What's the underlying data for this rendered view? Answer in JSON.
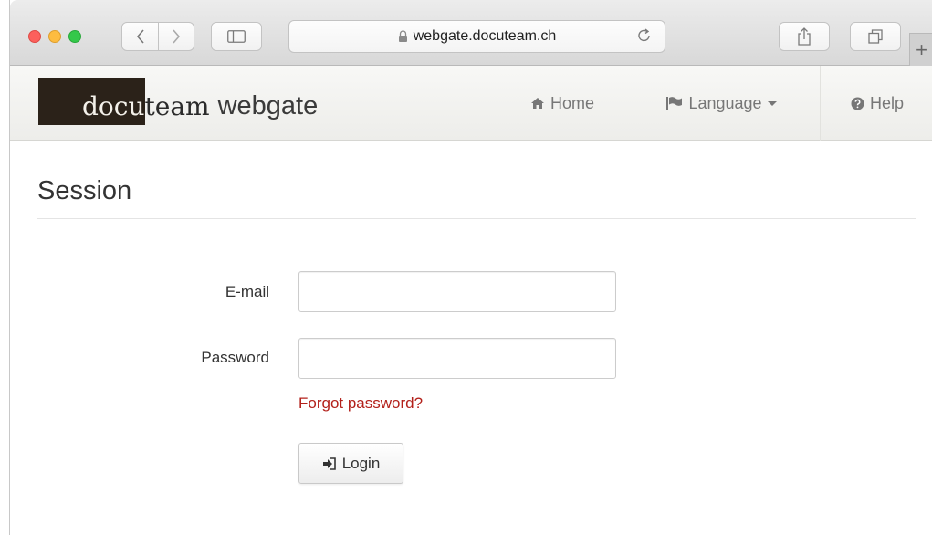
{
  "browser": {
    "address": "webgate.docuteam.ch",
    "icons": {
      "back": "chevron-left-icon",
      "forward": "chevron-right-icon",
      "sidebar": "sidebar-icon",
      "lock": "lock-icon",
      "reload": "reload-icon",
      "share": "share-icon",
      "tabs": "tabs-icon",
      "new_tab": "plus-icon"
    },
    "new_tab_label": "+"
  },
  "navbar": {
    "brand_part1": "docu",
    "brand_part2": "team",
    "brand_part3": "webgate",
    "items": [
      {
        "label": "Home",
        "icon": "home-icon"
      },
      {
        "label": "Language",
        "icon": "flag-icon"
      },
      {
        "label": "Help",
        "icon": "question-circle-icon"
      }
    ]
  },
  "page": {
    "title": "Session",
    "email_label": "E-mail",
    "email_value": "",
    "password_label": "Password",
    "password_value": "",
    "forgot_link": "Forgot password?",
    "login_button": "Login",
    "colors": {
      "link": "#b3211b",
      "brand_dark": "#2b2219"
    }
  }
}
